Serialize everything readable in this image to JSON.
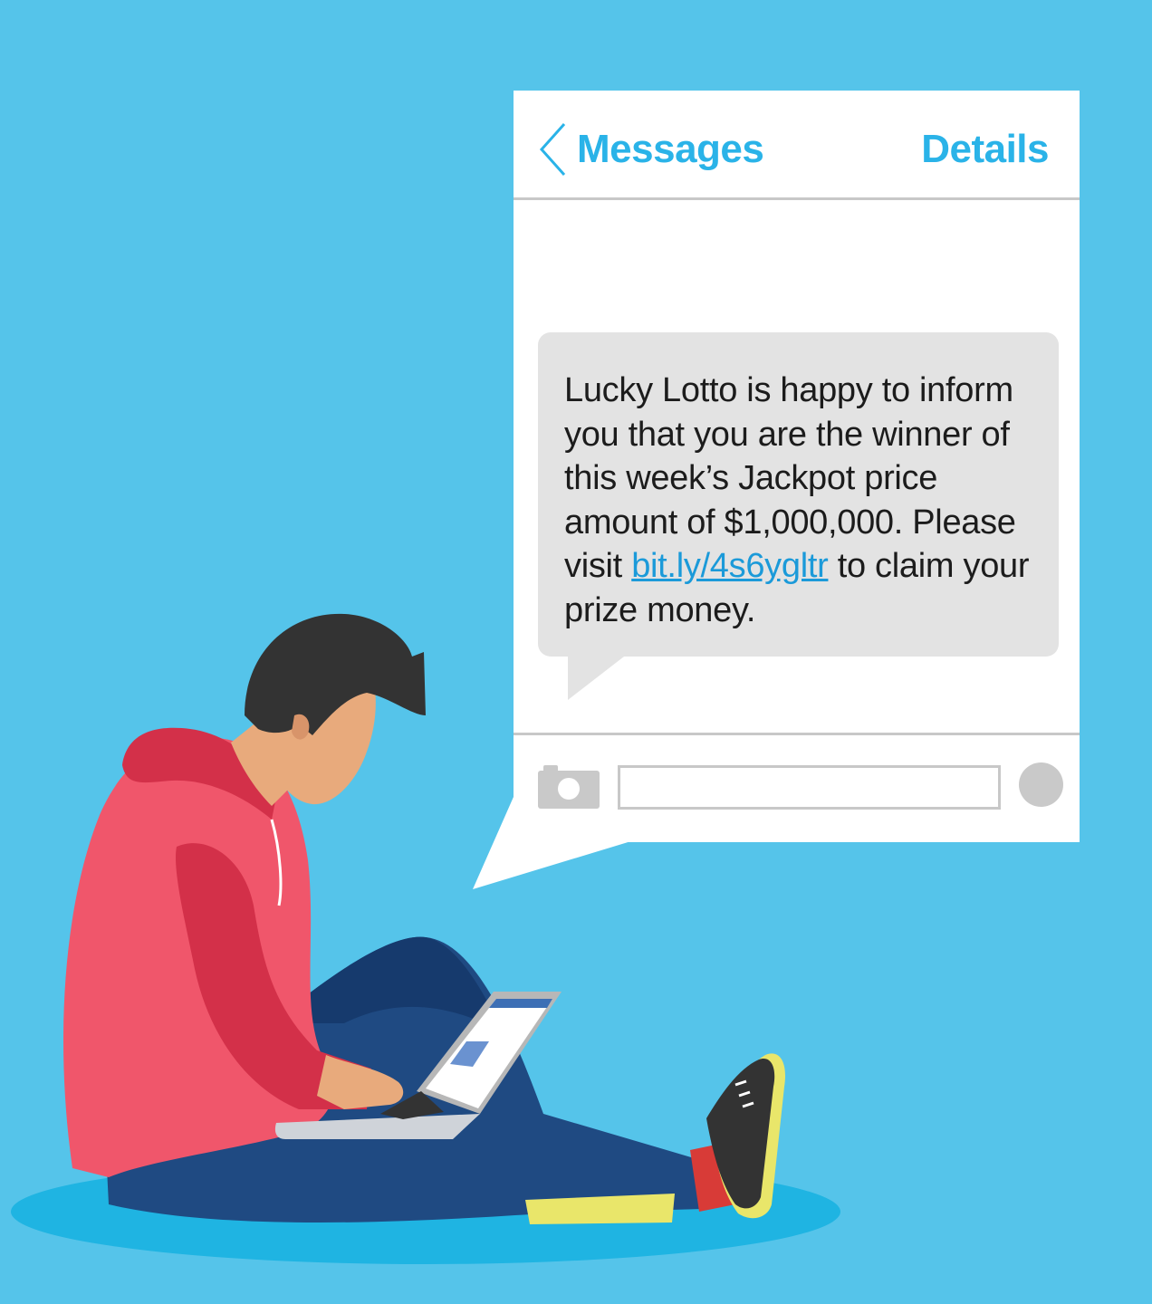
{
  "header": {
    "back_label": "Messages",
    "details_label": "Details"
  },
  "message": {
    "text_before_link": "Lucky Lotto is happy to inform you that you are the winner of this week’s Jackpot price amount of $1,000,000. Please visit ",
    "link": "bit.ly/4s6ygltr",
    "text_after_link": " to claim your prize money."
  },
  "composer": {
    "input_value": "",
    "camera_icon": "camera-icon",
    "send_icon": "send-icon"
  },
  "colors": {
    "background": "#55c4ea",
    "accent": "#2ab3e8",
    "bubble": "#e3e3e3",
    "link": "#1b9ad9"
  }
}
